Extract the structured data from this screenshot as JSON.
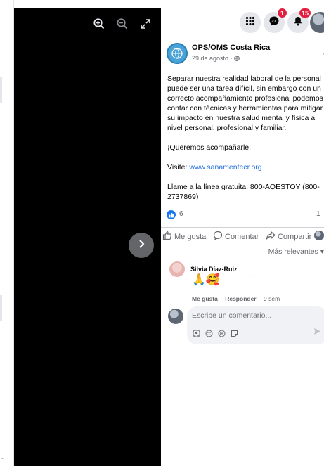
{
  "viewer": {
    "tools": [
      "zoom-in-icon",
      "zoom-out-icon",
      "fullscreen-icon"
    ],
    "next_icon": "chevron-right-icon"
  },
  "topbar": {
    "menu_icon": "grid-menu-icon",
    "messenger_badge": "1",
    "notifications_badge": "15"
  },
  "post": {
    "page_name": "OPS/OMS Costa Rica",
    "date": "29 de agosto · ",
    "more": "···",
    "body": [
      "Separar nuestra realidad laboral de la personal",
      "puede ser una tarea difícil, sin embargo con un",
      "correcto acompañamiento profesional podemos",
      "contar con técnicas y herramientas para mitigar",
      "su impacto en nuestra salud mental y física a",
      "nivel personal, profesional y familiar."
    ],
    "invite": "¡Queremos acompañarle!",
    "visit_label": "Visite: ",
    "visit_link": "www.sanamentecr.org",
    "call_line1": "Llame a la línea gratuita: 800-AQESTOY (800-",
    "call_line2": "2737869)",
    "like_count": "6",
    "comment_count": "1"
  },
  "actions": {
    "like": "Me gusta",
    "comment": "Comentar",
    "share": "Compartir"
  },
  "comments": {
    "sort_label": "Más relevantes",
    "items": [
      {
        "author": "Silvia Díaz-Ruiz",
        "content": "🙏🥰",
        "like": "Me gusta",
        "reply": "Responder",
        "time": "9 sem",
        "more": "···"
      }
    ],
    "input_placeholder": "Escribe un comentario...",
    "send_icon": "send-icon"
  },
  "colors": {
    "accent": "#1877f2",
    "link": "#216fdb",
    "badge": "#e41e3f"
  }
}
